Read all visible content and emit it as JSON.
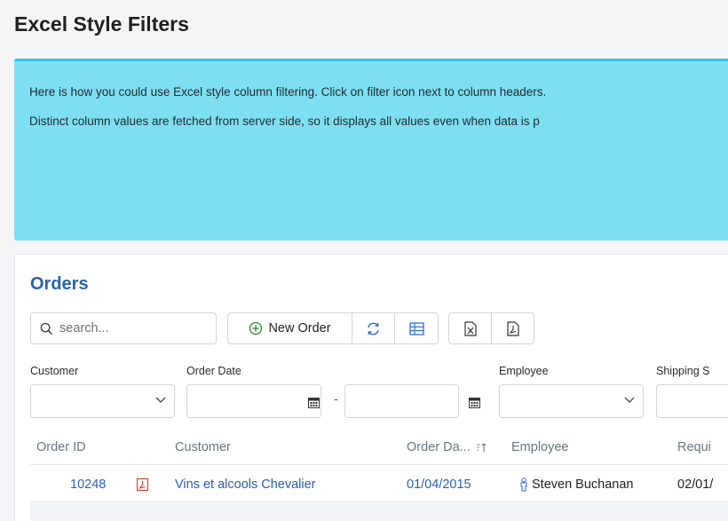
{
  "page": {
    "title": "Excel Style Filters"
  },
  "info": {
    "line1": "Here is how you could use Excel style column filtering. Click on filter icon next to column headers.",
    "line2": "Distinct column values are fetched from server side, so it displays all values even when data is p"
  },
  "card": {
    "title": "Orders",
    "search_placeholder": "search...",
    "new_order_label": "New Order"
  },
  "filters": {
    "customer_label": "Customer",
    "order_date_label": "Order Date",
    "date_separator": "-",
    "employee_label": "Employee",
    "shipping_label": "Shipping S"
  },
  "table": {
    "headers": {
      "order_id": "Order ID",
      "customer": "Customer",
      "order_date": "Order Da...",
      "employee": "Employee",
      "required": "Requi"
    },
    "rows": [
      {
        "order_id": "10248",
        "customer": "Vins et alcools Chevalier",
        "order_date": "01/04/2015",
        "employee": "Steven Buchanan",
        "required": "02/01/"
      }
    ]
  },
  "colors": {
    "accent": "#2a63a8",
    "info_bg": "#7fdff2",
    "info_border": "#34c5e8",
    "pdf_red": "#d9342b"
  },
  "icons": [
    "search-icon",
    "plus-circle-icon",
    "refresh-icon",
    "column-picker-icon",
    "excel-export-icon",
    "pdf-export-icon",
    "calendar-icon",
    "chevron-down-icon",
    "sort-icon",
    "person-icon",
    "pdf-icon"
  ]
}
